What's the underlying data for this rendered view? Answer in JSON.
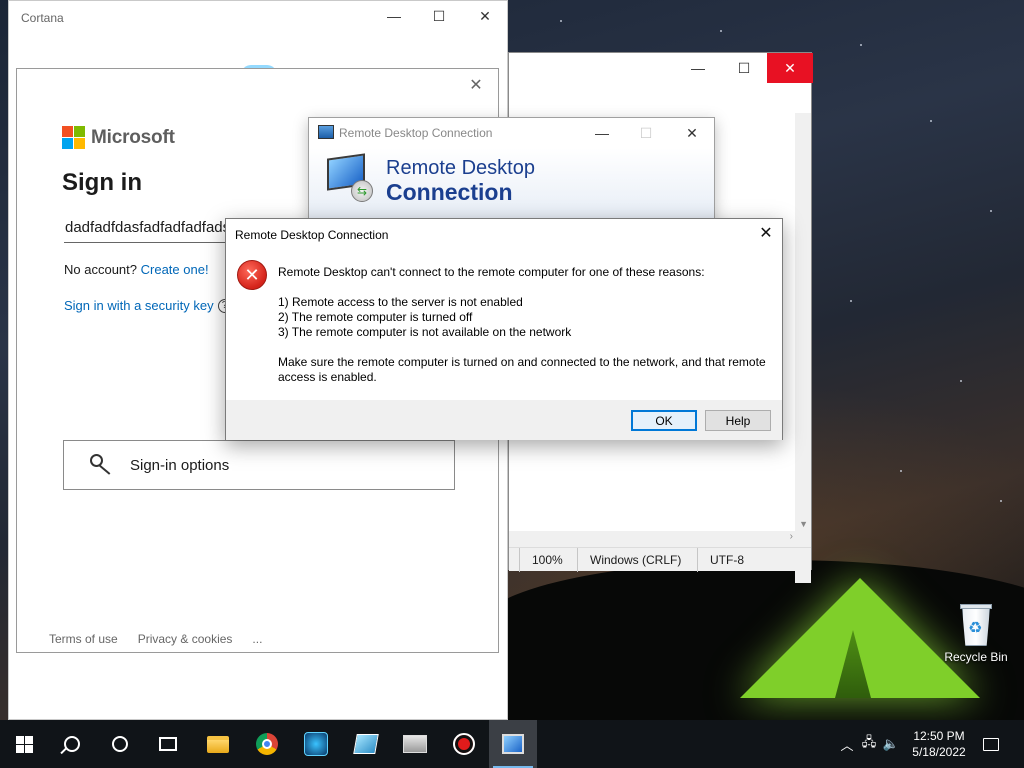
{
  "desktop": {
    "recycle_bin_label": "Recycle Bin"
  },
  "cortana": {
    "title": "Cortana",
    "buttons": {
      "minimize": "—",
      "maximize": "☐",
      "close": "✕"
    }
  },
  "signin": {
    "brand": "Microsoft",
    "brand_colors": [
      "#f25022",
      "#7fba00",
      "#00a4ef",
      "#ffb900"
    ],
    "title": "Sign in",
    "email_value": "dadfadfdasfadfadfadfads",
    "no_account_text": "No account?",
    "create_link": "Create one!",
    "security_key_link": "Sign in with a security key",
    "help_icon": "?",
    "options_label": "Sign-in options",
    "footer": {
      "terms": "Terms of use",
      "privacy": "Privacy & cookies",
      "more": "..."
    }
  },
  "notepad": {
    "status": {
      "zoom": "100%",
      "line_ending": "Windows (CRLF)",
      "encoding": "UTF-8"
    }
  },
  "rdc": {
    "title": "Remote Desktop Connection",
    "banner_line1": "Remote Desktop",
    "banner_line2": "Connection"
  },
  "error_dialog": {
    "title": "Remote Desktop Connection",
    "message_intro": "Remote Desktop can't connect to the remote computer for one of these reasons:",
    "reasons": [
      "1) Remote access to the server is not enabled",
      "2) The remote computer is turned off",
      "3) The remote computer is not available on the network"
    ],
    "message_outro": "Make sure the remote computer is turned on and connected to the network, and that remote access is enabled.",
    "ok_label": "OK",
    "help_label": "Help"
  },
  "taskbar": {
    "clock_time": "12:50 PM",
    "clock_date": "5/18/2022",
    "icons": [
      "start-icon",
      "search-icon",
      "cortana-icon",
      "task-view-icon",
      "file-explorer-icon",
      "chrome-icon",
      "app-icon",
      "app-icon",
      "app-icon",
      "record-icon",
      "remote-desktop-icon"
    ]
  }
}
